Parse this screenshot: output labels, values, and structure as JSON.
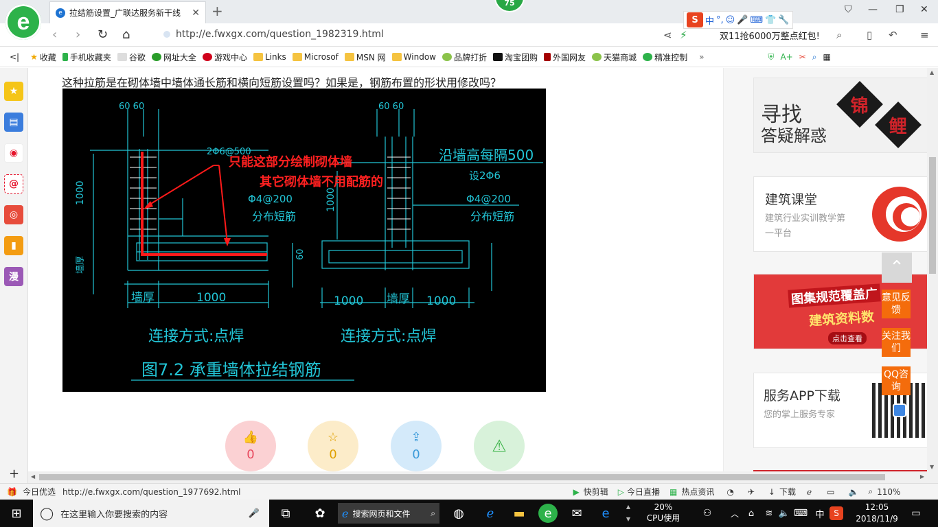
{
  "browser": {
    "badge": "75",
    "tab_title": "拉结筋设置_广联达服务新干线",
    "url": "http://e.fwxgx.com/question_1982319.html",
    "promo": "双11抢6000万整点红包!",
    "ime_chars": [
      "中",
      "°,"
    ],
    "status_url": "http://e.fwxgx.com/question_1977692.html",
    "status_left": "今日优选",
    "status_items": [
      "快剪辑",
      "今日直播",
      "热点资讯",
      "下载"
    ],
    "zoom": "110%"
  },
  "bookmarks": [
    "收藏",
    "手机收藏夹",
    "谷歌",
    "网址大全",
    "游戏中心",
    "Links",
    "Microsof",
    "MSN 网",
    "Window",
    "品牌打折",
    "淘宝团购",
    "外国网友",
    "天猫商城",
    "精准控制"
  ],
  "sidebar_icons": [
    "star-icon",
    "news-icon",
    "weibo-icon",
    "mail-icon",
    "game-icon",
    "book-icon",
    "comic-icon"
  ],
  "sidebar_comic_label": "漫",
  "question": {
    "text": "这种拉筋是在砌体墙中墙体通长筋和横向短筋设置吗？如果是，钢筋布置的形状用修改吗？"
  },
  "figure": {
    "note_line1": "只能这部分绘制砌体墙",
    "note_line2": "其它砌体墙不用配筋的",
    "dim_top_left": "60  60",
    "dim_top_right": "60  60",
    "label_2phi6": "2Φ6@500",
    "label_along_wall": "沿墙高每隔500",
    "label_set": "设2Φ6",
    "label_phi4_left": "Φ4@200",
    "label_phi4_right": "Φ4@200",
    "label_dist_left": "分布短筋",
    "label_dist_right": "分布短筋",
    "label_1000_left": "1000",
    "label_1000_mid": "1000",
    "label_wall_left": "墙厚",
    "label_wall_mid": "墙厚",
    "label_bottom_1000": "1000",
    "label_bottom_1000b": "1000",
    "label_1000_b1": "1000",
    "label_1000_b2": "1000",
    "label_60": "60",
    "label_side": "墙厚",
    "conn_left": "连接方式:点焊",
    "conn_right": "连接方式:点焊",
    "caption": "图7.2  承重墙体拉结钢筋"
  },
  "actions": {
    "like_count": "0",
    "fav_count": "0",
    "share_count": "0"
  },
  "right": {
    "ad1_line1": "寻找",
    "ad1_line2": "答疑解惑",
    "ad1_char1": "锦",
    "ad1_char2": "鲤",
    "class_title": "建筑课堂",
    "class_desc": "建筑行业实训教学第一平台",
    "ad2_line1": "图集规范覆盖广",
    "ad2_line2": "建筑资料数",
    "ad2_btn": "点击查看",
    "app_title": "服务APP下载",
    "app_desc": "您的掌上服务专家",
    "float_feedback": "意见反馈",
    "float_follow": "关注我们",
    "float_qq": "QQ咨询"
  },
  "taskbar": {
    "search_placeholder": "在这里输入你要搜索的内容",
    "web_search": "搜索网页和文件",
    "cpu_percent": "20%",
    "cpu_label": "CPU使用",
    "lang": "中",
    "time": "12:05",
    "date": "2018/11/9"
  }
}
